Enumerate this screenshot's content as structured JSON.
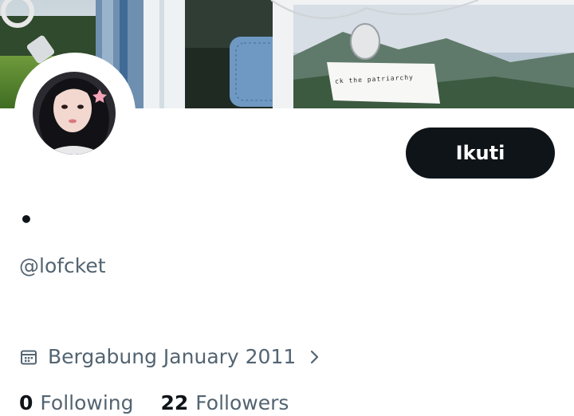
{
  "banner": {
    "caption": "ck the patriarchy"
  },
  "profile": {
    "display_name": "•",
    "handle": "@lofcket",
    "joined_text": "Bergabung January 2011",
    "follow_label": "Ikuti"
  },
  "stats": {
    "following_count": "0",
    "following_label": "Following",
    "followers_count": "22",
    "followers_label": "Followers"
  },
  "icons": {
    "joined": "calendar-icon",
    "joined_more": "chevron-right-icon"
  },
  "colors": {
    "text_primary": "#0f1419",
    "text_secondary": "#536471",
    "button_bg": "#0f1419",
    "button_text": "#ffffff"
  }
}
